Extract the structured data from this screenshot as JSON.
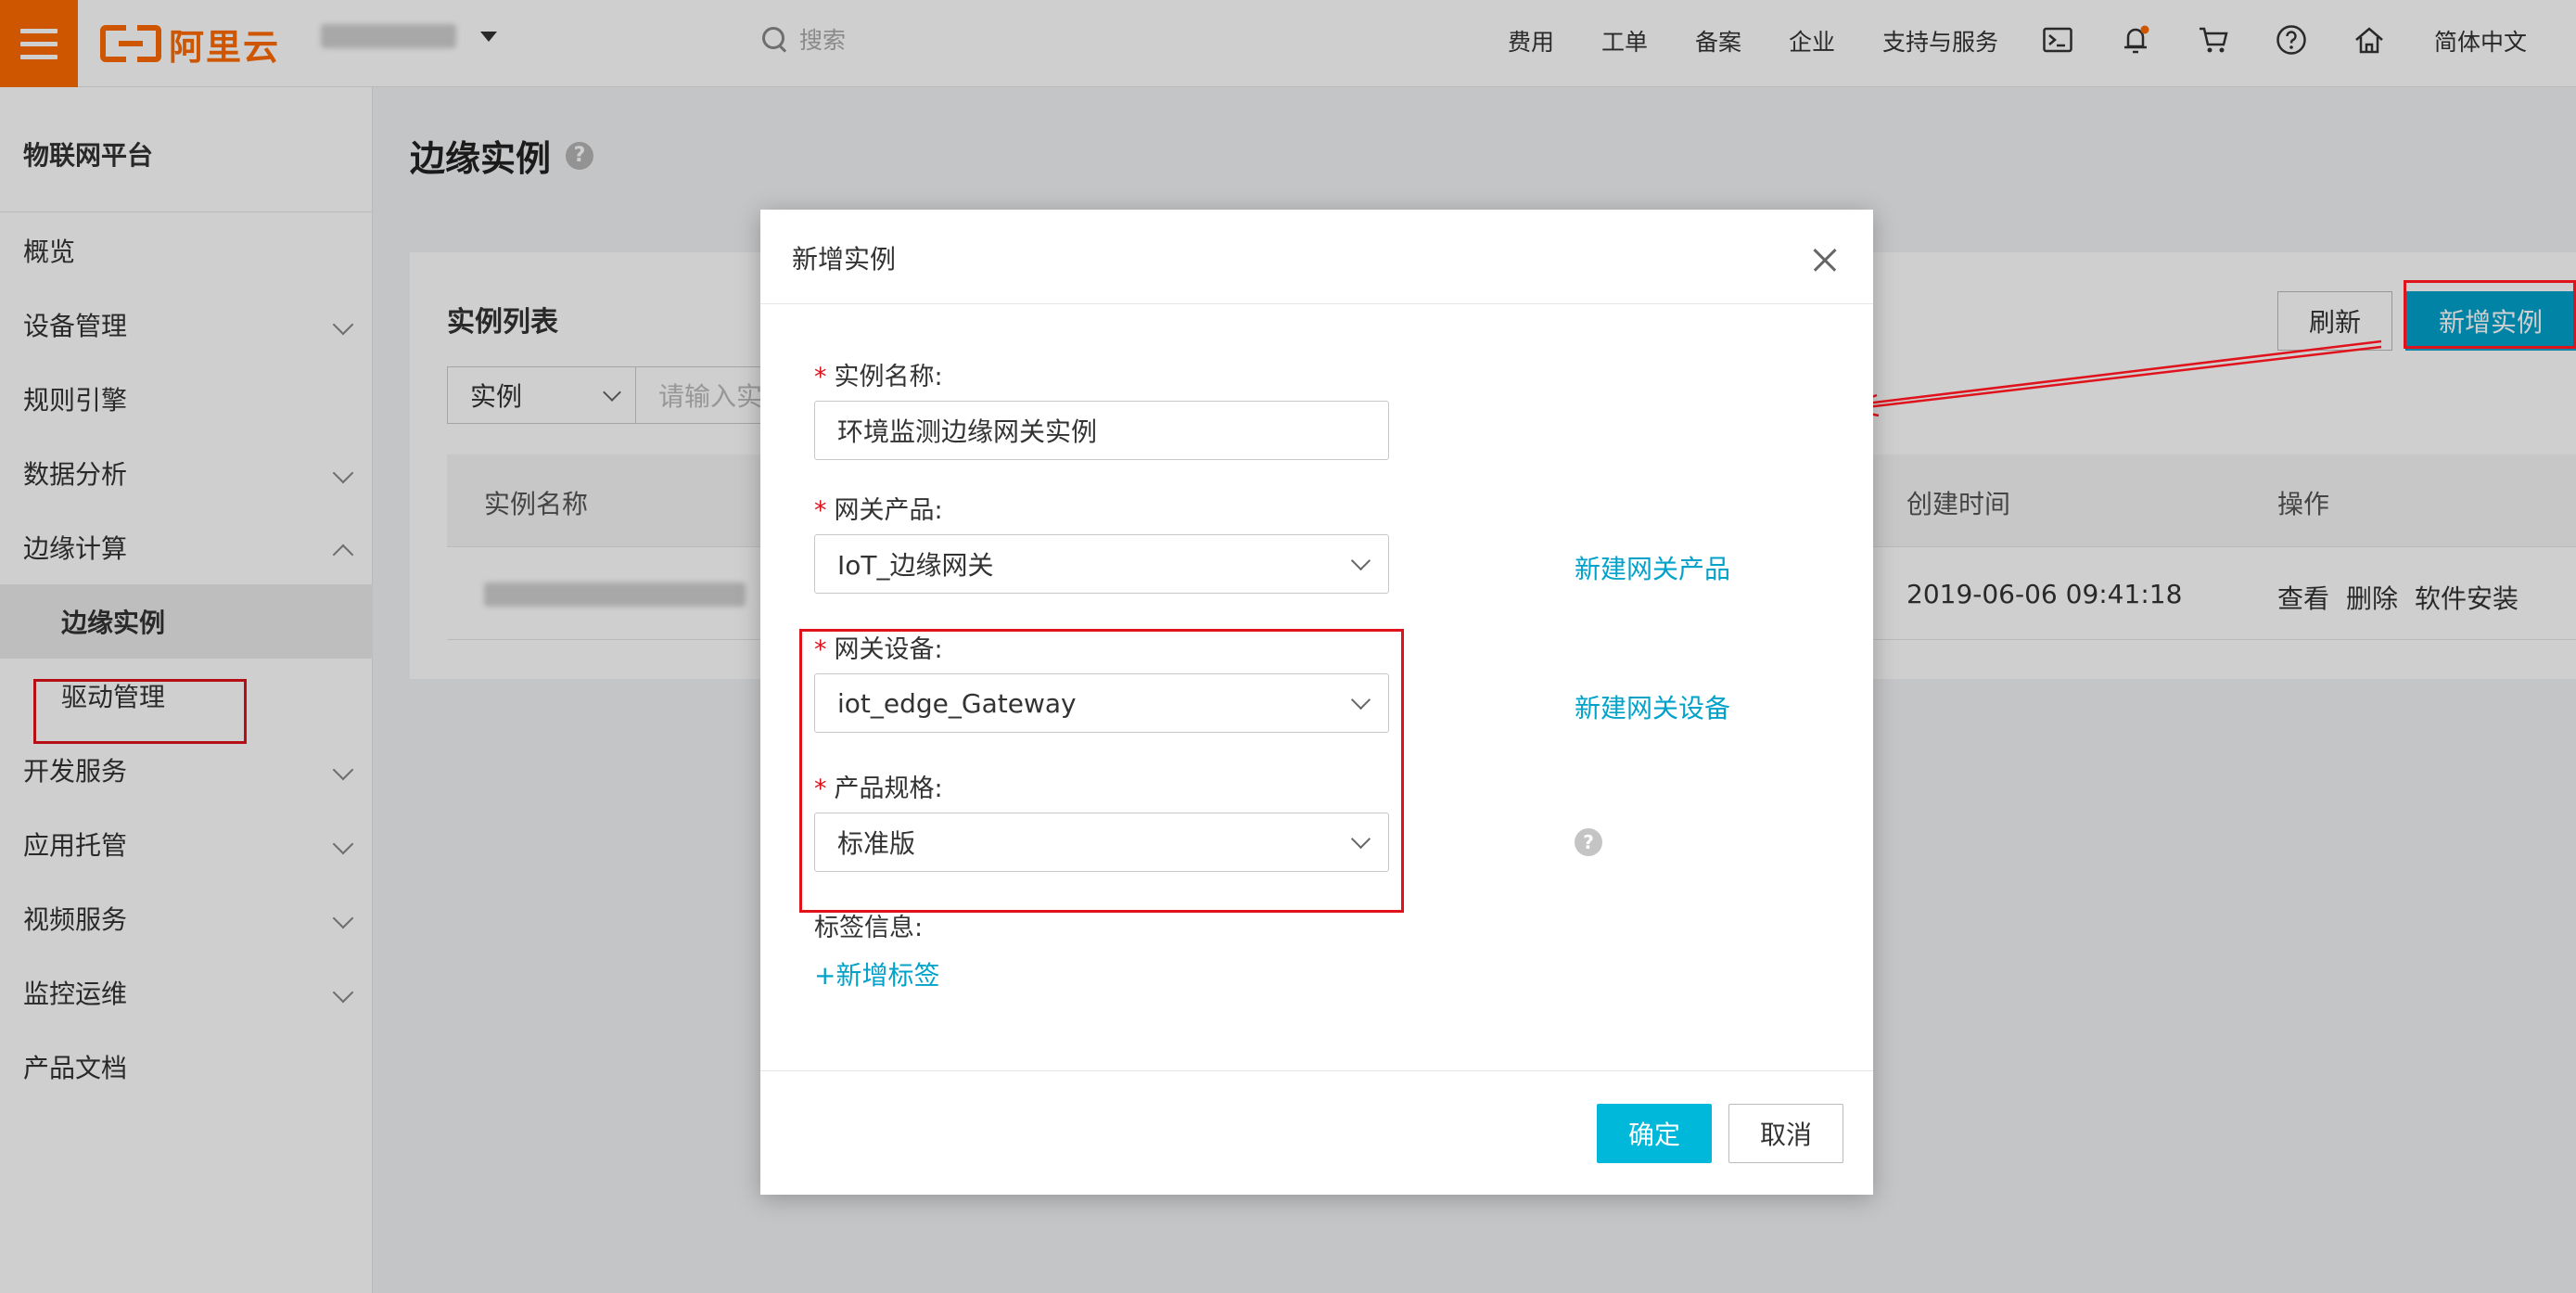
{
  "topbar": {
    "brand": "阿里云",
    "search_placeholder": "搜索",
    "nav": [
      "费用",
      "工单",
      "备案",
      "企业",
      "支持与服务"
    ],
    "language": "简体中文",
    "icons": [
      "terminal-icon",
      "bell-icon",
      "cart-icon",
      "question-icon",
      "home-icon"
    ]
  },
  "sidebar": {
    "title": "物联网平台",
    "items": [
      {
        "label": "概览"
      },
      {
        "label": "设备管理"
      },
      {
        "label": "规则引擎"
      },
      {
        "label": "数据分析"
      },
      {
        "label": "边缘计算"
      },
      {
        "label": "边缘实例"
      },
      {
        "label": "驱动管理"
      },
      {
        "label": "开发服务"
      },
      {
        "label": "应用托管"
      },
      {
        "label": "视频服务"
      },
      {
        "label": "监控运维"
      },
      {
        "label": "产品文档"
      }
    ]
  },
  "main": {
    "title": "边缘实例",
    "list_title": "实例列表",
    "filter_select": "实例",
    "filter_placeholder": "请输入实",
    "refresh_label": "刷新",
    "new_label": "新增实例",
    "columns": {
      "name": "实例名称",
      "created": "创建时间",
      "actions": "操作"
    },
    "row": {
      "created": "2019-06-06 09:41:18",
      "actions": [
        "查看",
        "删除",
        "软件安装"
      ]
    }
  },
  "modal": {
    "title": "新增实例",
    "fields": {
      "name": {
        "label": "实例名称:",
        "value": "环境监测边缘网关实例"
      },
      "product": {
        "label": "网关产品:",
        "value": "IoT_边缘网关",
        "link": "新建网关产品"
      },
      "device": {
        "label": "网关设备:",
        "value": "iot_edge_Gateway",
        "link": "新建网关设备"
      },
      "spec": {
        "label": "产品规格:",
        "value": "标准版"
      }
    },
    "tags_label": "标签信息:",
    "add_tag": "+新增标签",
    "ok_label": "确定",
    "cancel_label": "取消"
  },
  "colors": {
    "brand": "#ff6a00",
    "accent": "#00a2ca",
    "highlight": "#e0121b"
  }
}
